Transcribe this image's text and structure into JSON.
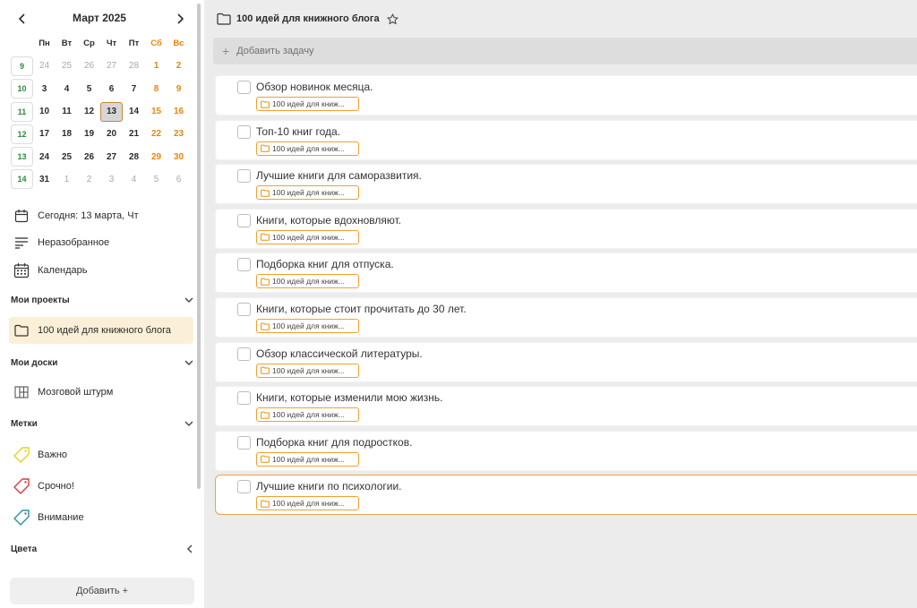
{
  "calendar": {
    "month_label": "Март 2025",
    "weekday_headers": [
      "Пн",
      "Вт",
      "Ср",
      "Чт",
      "Пт",
      "Сб",
      "Вс"
    ],
    "weeks": [
      {
        "num": "9",
        "days": [
          "24",
          "25",
          "26",
          "27",
          "28",
          "1",
          "2"
        ]
      },
      {
        "num": "10",
        "days": [
          "3",
          "4",
          "5",
          "6",
          "7",
          "8",
          "9"
        ]
      },
      {
        "num": "11",
        "days": [
          "10",
          "11",
          "12",
          "13",
          "14",
          "15",
          "16"
        ]
      },
      {
        "num": "12",
        "days": [
          "17",
          "18",
          "19",
          "20",
          "21",
          "22",
          "23"
        ]
      },
      {
        "num": "13",
        "days": [
          "24",
          "25",
          "26",
          "27",
          "28",
          "29",
          "30"
        ]
      },
      {
        "num": "14",
        "days": [
          "31",
          "1",
          "2",
          "3",
          "4",
          "5",
          "6"
        ]
      }
    ],
    "today": "13"
  },
  "sidebar": {
    "today_label": "Сегодня: 13 марта, Чт",
    "inbox_label": "Неразобранное",
    "calendar_label": "Календарь",
    "projects_header": "Мои проекты",
    "project_item": "100 идей для книжного блога",
    "boards_header": "Мои доски",
    "board_item": "Мозговой штурм",
    "labels_header": "Метки",
    "labels": [
      {
        "label": "Важно",
        "color": "#e6d020"
      },
      {
        "label": "Срочно!",
        "color": "#d93a3a"
      },
      {
        "label": "Внимание",
        "color": "#2a8fa0"
      }
    ],
    "colors_header": "Цвета",
    "add_button": "Добавить +"
  },
  "main": {
    "title": "100 идей для книжного блога",
    "add_task_placeholder": "Добавить задачу",
    "tasks": [
      {
        "text": "Обзор новинок месяца.",
        "tag": "100 идей для книж..."
      },
      {
        "text": "Топ-10 книг года.",
        "tag": "100 идей для книж..."
      },
      {
        "text": "Лучшие книги для саморазвития.",
        "tag": "100 идей для книж..."
      },
      {
        "text": "Книги, которые вдохновляют.",
        "tag": "100 идей для книж..."
      },
      {
        "text": "Подборка книг для отпуска.",
        "tag": "100 идей для книж..."
      },
      {
        "text": "Книги, которые стоит прочитать до 30 лет.",
        "tag": "100 идей для книж..."
      },
      {
        "text": "Обзор классической литературы.",
        "tag": "100 идей для книж..."
      },
      {
        "text": "Книги, которые изменили мою жизнь.",
        "tag": "100 идей для книж..."
      },
      {
        "text": "Подборка книг для подростков.",
        "tag": "100 идей для книж..."
      },
      {
        "text": "Лучшие книги по психологии.",
        "tag": "100 идей для книж..."
      }
    ]
  },
  "colors": {
    "accent_orange": "#f0a030",
    "week_green": "#2e8b3a",
    "weekend_orange": "#e8860a",
    "active_project_bg": "#fcefd8"
  }
}
